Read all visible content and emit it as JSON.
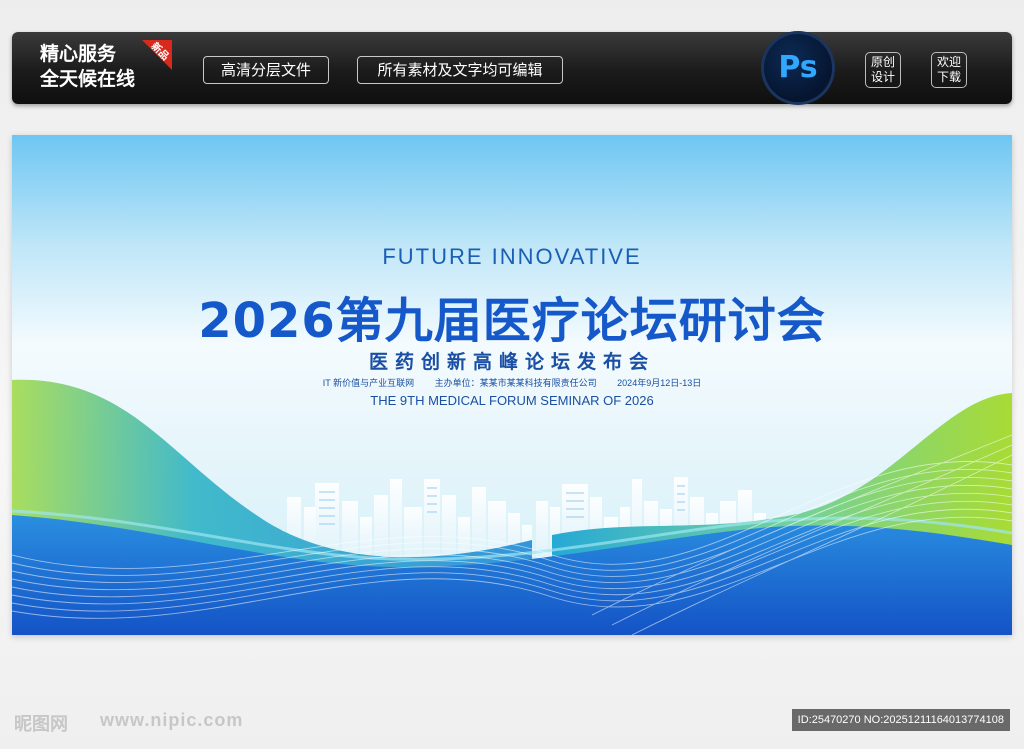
{
  "banner": {
    "service_line1": "精心服务",
    "service_line2": "全天候在线",
    "new_tag": "新品",
    "pill1": "高清分层文件",
    "pill2": "所有素材及文字均可编辑",
    "ps_label": "Ps",
    "box1_line1": "原创",
    "box1_line2": "设计",
    "box2_line1": "欢迎",
    "box2_line2": "下载"
  },
  "poster": {
    "title_en": "FUTURE INNOVATIVE",
    "title_main": "2026第九届医疗论坛研讨会",
    "subtitle": "医药创新高峰论坛发布会",
    "info": [
      "IT 新价值与产业互联网",
      "主办单位：某某市某某科技有限责任公司",
      "2024年9月12日-13日"
    ],
    "seminar_en": "THE 9TH MEDICAL FORUM SEMINAR OF 2026"
  },
  "watermark": {
    "logo": "昵图网",
    "url": "www.nipic.com",
    "id": "ID:25470270 NO:20251211164013774108"
  },
  "colors": {
    "title_blue": "#1558c9",
    "wave_green": "#8fd43a",
    "wave_blue": "#1e6fd6",
    "new_tag_red": "#d9291c",
    "ps_blue": "#31a8ff"
  }
}
